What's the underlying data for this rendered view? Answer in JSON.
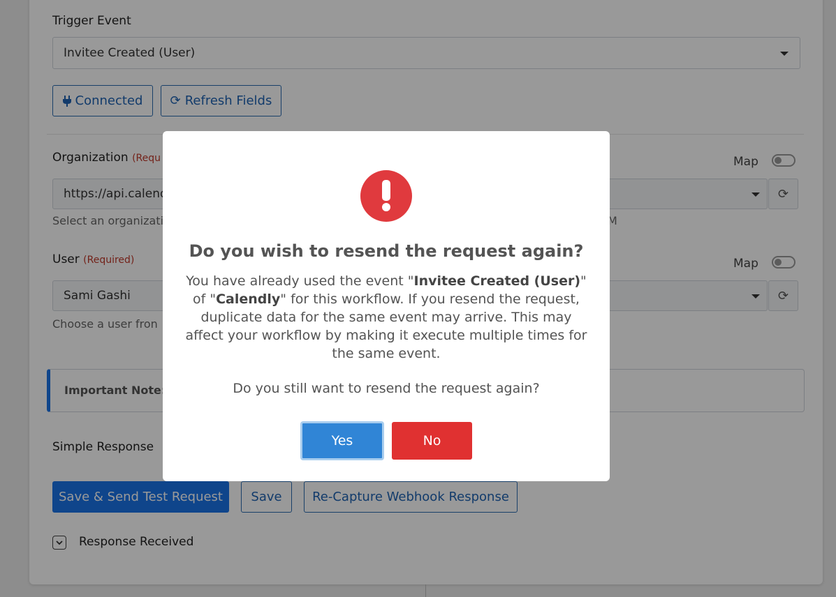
{
  "trigger": {
    "label": "Trigger Event",
    "value": "Invitee Created (User)",
    "connected_label": "Connected",
    "refresh_label": "Refresh Fields"
  },
  "organization": {
    "label": "Organization",
    "required": "(Requ",
    "value": "https://api.calendl",
    "help": "Select an organizati",
    "help_tail": "M",
    "map_label": "Map"
  },
  "user": {
    "label": "User",
    "required": "(Required)",
    "value": "Sami Gashi",
    "help": "Choose a user fron",
    "map_label": "Map"
  },
  "note": {
    "label": "Important Note:"
  },
  "response": {
    "label": "Simple Response"
  },
  "actions": {
    "save_send": "Save & Send Test Request",
    "save": "Save",
    "recapture": "Re-Capture Webhook Response"
  },
  "response_received": {
    "label": "Response Received"
  },
  "modal": {
    "title": "Do you wish to resend the request again?",
    "text_1": "You have already used the event \"",
    "event": "Invitee Created (User)",
    "text_2": "\" of \"",
    "app": "Calendly",
    "text_3": "\" for this workflow. If you resend the request, duplicate data for the same event may arrive. This may affect your workflow by making it execute multiple times for the same event.",
    "question": "Do you still want to resend the request again?",
    "yes": "Yes",
    "no": "No"
  },
  "colors": {
    "primary": "#1a73e8",
    "danger": "#e03131",
    "warning": "#e03a3e"
  }
}
